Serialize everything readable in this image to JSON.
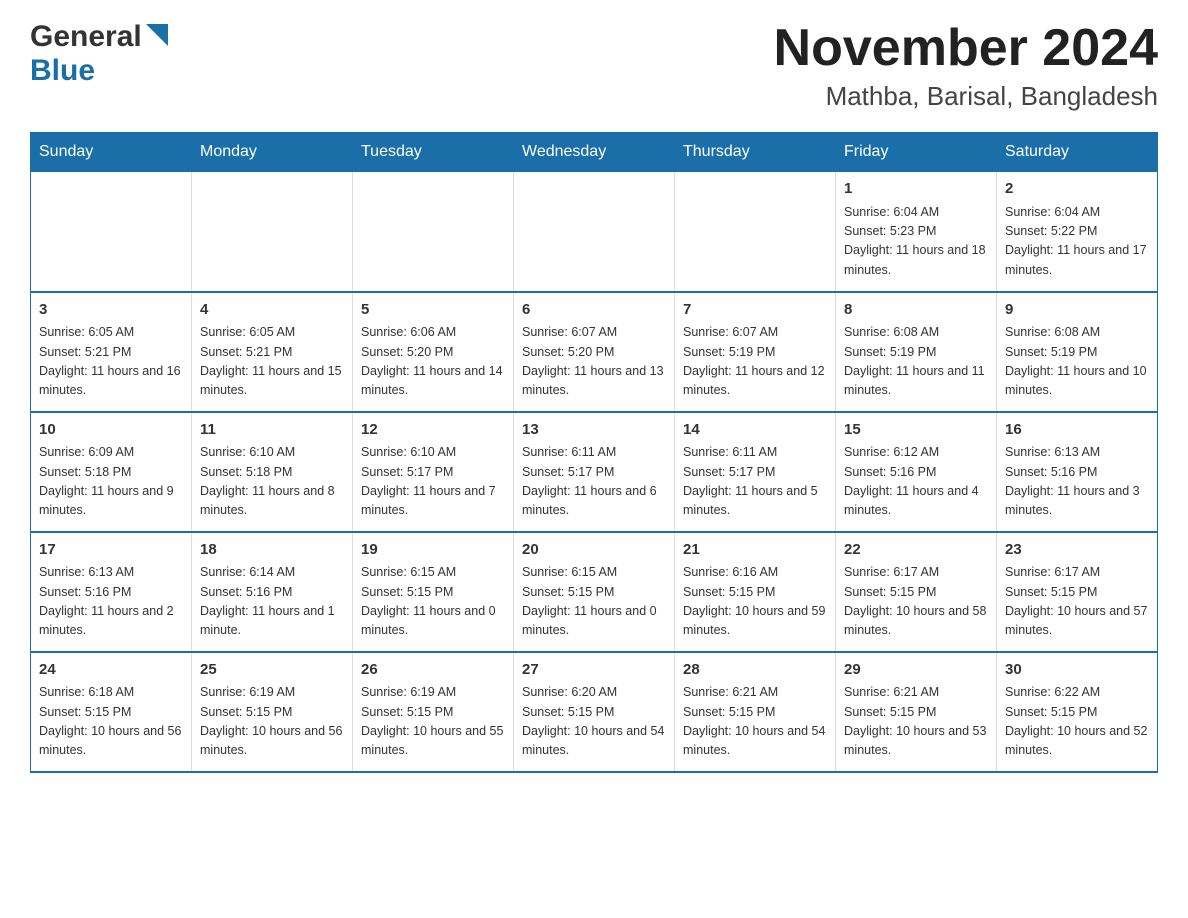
{
  "header": {
    "logo_general": "General",
    "logo_blue": "Blue",
    "month_year": "November 2024",
    "location": "Mathba, Barisal, Bangladesh"
  },
  "weekdays": [
    "Sunday",
    "Monday",
    "Tuesday",
    "Wednesday",
    "Thursday",
    "Friday",
    "Saturday"
  ],
  "weeks": [
    [
      {
        "num": "",
        "info": ""
      },
      {
        "num": "",
        "info": ""
      },
      {
        "num": "",
        "info": ""
      },
      {
        "num": "",
        "info": ""
      },
      {
        "num": "",
        "info": ""
      },
      {
        "num": "1",
        "info": "Sunrise: 6:04 AM\nSunset: 5:23 PM\nDaylight: 11 hours and 18 minutes."
      },
      {
        "num": "2",
        "info": "Sunrise: 6:04 AM\nSunset: 5:22 PM\nDaylight: 11 hours and 17 minutes."
      }
    ],
    [
      {
        "num": "3",
        "info": "Sunrise: 6:05 AM\nSunset: 5:21 PM\nDaylight: 11 hours and 16 minutes."
      },
      {
        "num": "4",
        "info": "Sunrise: 6:05 AM\nSunset: 5:21 PM\nDaylight: 11 hours and 15 minutes."
      },
      {
        "num": "5",
        "info": "Sunrise: 6:06 AM\nSunset: 5:20 PM\nDaylight: 11 hours and 14 minutes."
      },
      {
        "num": "6",
        "info": "Sunrise: 6:07 AM\nSunset: 5:20 PM\nDaylight: 11 hours and 13 minutes."
      },
      {
        "num": "7",
        "info": "Sunrise: 6:07 AM\nSunset: 5:19 PM\nDaylight: 11 hours and 12 minutes."
      },
      {
        "num": "8",
        "info": "Sunrise: 6:08 AM\nSunset: 5:19 PM\nDaylight: 11 hours and 11 minutes."
      },
      {
        "num": "9",
        "info": "Sunrise: 6:08 AM\nSunset: 5:19 PM\nDaylight: 11 hours and 10 minutes."
      }
    ],
    [
      {
        "num": "10",
        "info": "Sunrise: 6:09 AM\nSunset: 5:18 PM\nDaylight: 11 hours and 9 minutes."
      },
      {
        "num": "11",
        "info": "Sunrise: 6:10 AM\nSunset: 5:18 PM\nDaylight: 11 hours and 8 minutes."
      },
      {
        "num": "12",
        "info": "Sunrise: 6:10 AM\nSunset: 5:17 PM\nDaylight: 11 hours and 7 minutes."
      },
      {
        "num": "13",
        "info": "Sunrise: 6:11 AM\nSunset: 5:17 PM\nDaylight: 11 hours and 6 minutes."
      },
      {
        "num": "14",
        "info": "Sunrise: 6:11 AM\nSunset: 5:17 PM\nDaylight: 11 hours and 5 minutes."
      },
      {
        "num": "15",
        "info": "Sunrise: 6:12 AM\nSunset: 5:16 PM\nDaylight: 11 hours and 4 minutes."
      },
      {
        "num": "16",
        "info": "Sunrise: 6:13 AM\nSunset: 5:16 PM\nDaylight: 11 hours and 3 minutes."
      }
    ],
    [
      {
        "num": "17",
        "info": "Sunrise: 6:13 AM\nSunset: 5:16 PM\nDaylight: 11 hours and 2 minutes."
      },
      {
        "num": "18",
        "info": "Sunrise: 6:14 AM\nSunset: 5:16 PM\nDaylight: 11 hours and 1 minute."
      },
      {
        "num": "19",
        "info": "Sunrise: 6:15 AM\nSunset: 5:15 PM\nDaylight: 11 hours and 0 minutes."
      },
      {
        "num": "20",
        "info": "Sunrise: 6:15 AM\nSunset: 5:15 PM\nDaylight: 11 hours and 0 minutes."
      },
      {
        "num": "21",
        "info": "Sunrise: 6:16 AM\nSunset: 5:15 PM\nDaylight: 10 hours and 59 minutes."
      },
      {
        "num": "22",
        "info": "Sunrise: 6:17 AM\nSunset: 5:15 PM\nDaylight: 10 hours and 58 minutes."
      },
      {
        "num": "23",
        "info": "Sunrise: 6:17 AM\nSunset: 5:15 PM\nDaylight: 10 hours and 57 minutes."
      }
    ],
    [
      {
        "num": "24",
        "info": "Sunrise: 6:18 AM\nSunset: 5:15 PM\nDaylight: 10 hours and 56 minutes."
      },
      {
        "num": "25",
        "info": "Sunrise: 6:19 AM\nSunset: 5:15 PM\nDaylight: 10 hours and 56 minutes."
      },
      {
        "num": "26",
        "info": "Sunrise: 6:19 AM\nSunset: 5:15 PM\nDaylight: 10 hours and 55 minutes."
      },
      {
        "num": "27",
        "info": "Sunrise: 6:20 AM\nSunset: 5:15 PM\nDaylight: 10 hours and 54 minutes."
      },
      {
        "num": "28",
        "info": "Sunrise: 6:21 AM\nSunset: 5:15 PM\nDaylight: 10 hours and 54 minutes."
      },
      {
        "num": "29",
        "info": "Sunrise: 6:21 AM\nSunset: 5:15 PM\nDaylight: 10 hours and 53 minutes."
      },
      {
        "num": "30",
        "info": "Sunrise: 6:22 AM\nSunset: 5:15 PM\nDaylight: 10 hours and 52 minutes."
      }
    ]
  ]
}
